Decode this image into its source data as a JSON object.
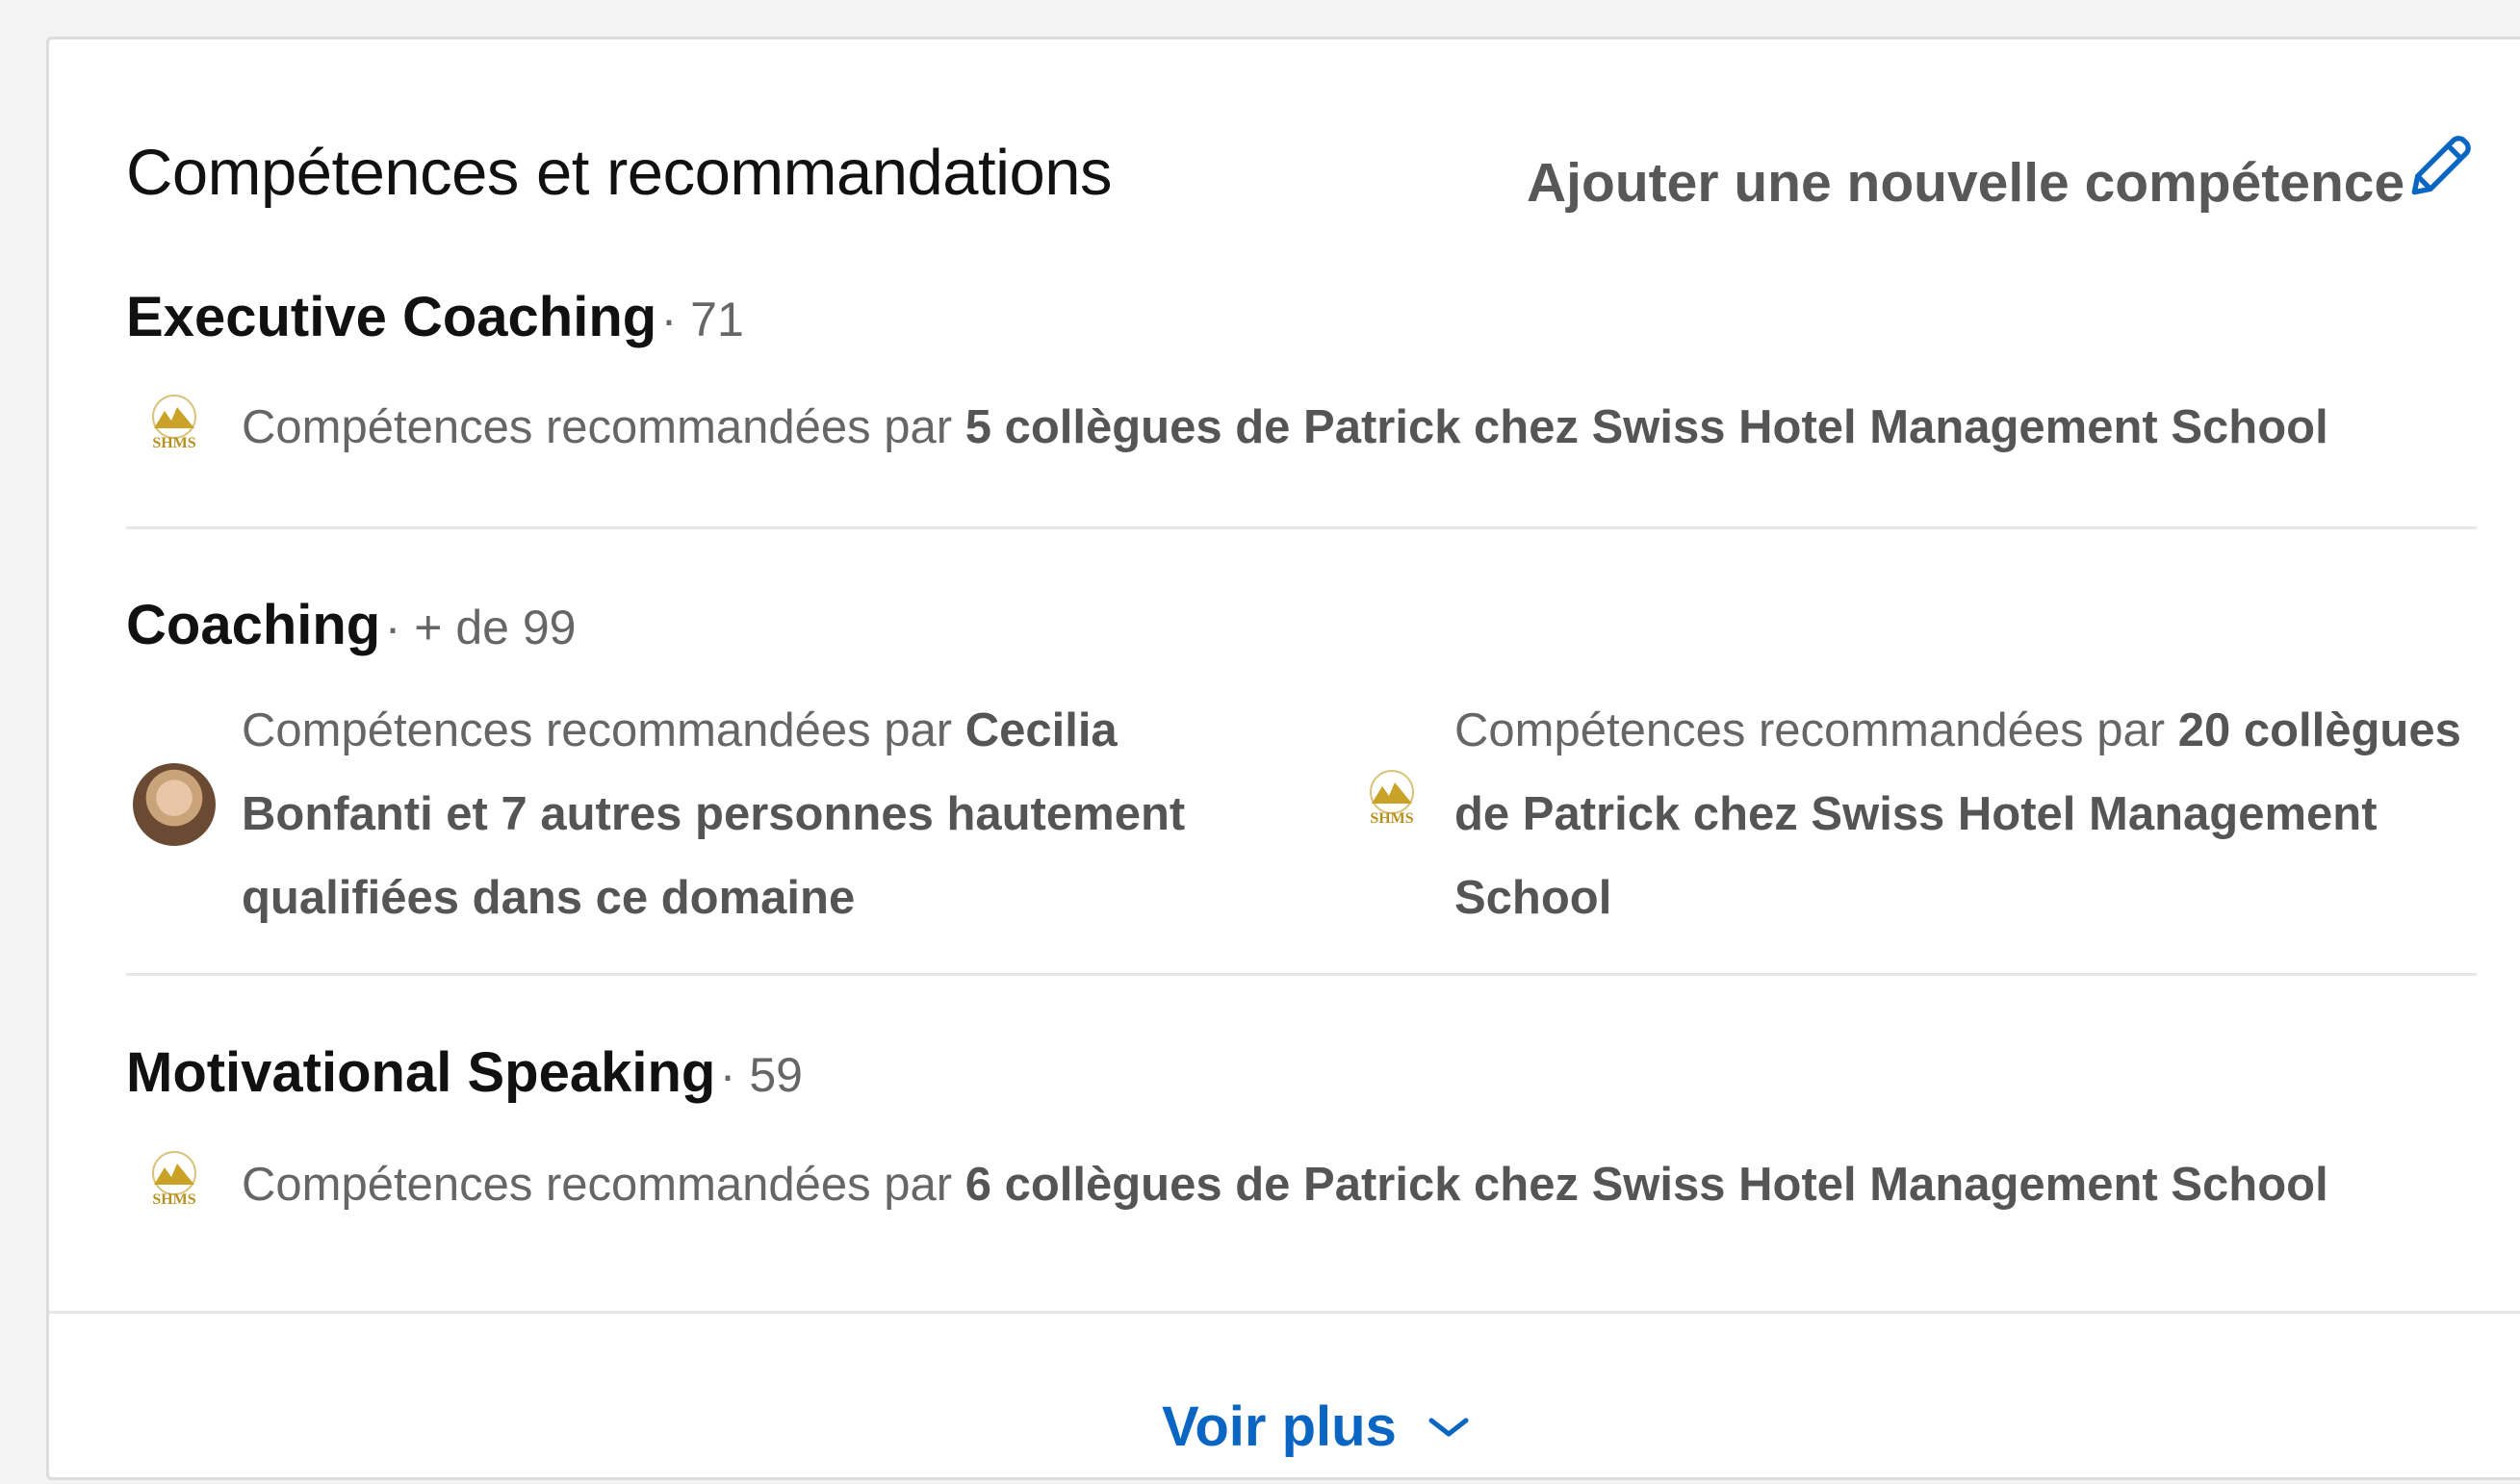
{
  "section": {
    "title": "Compétences et recommandations",
    "add_skill_label": "Ajouter une nouvelle compétence"
  },
  "skills": [
    {
      "name": "Executive Coaching",
      "count": "· 71",
      "endorsements": [
        {
          "source": "logo",
          "prefix": "Compétences recommandées par ",
          "bold": "5 collègues de Patrick chez Swiss Hotel Management School"
        }
      ]
    },
    {
      "name": "Coaching",
      "count": "· + de 99",
      "endorsements": [
        {
          "source": "avatar",
          "prefix": "Compétences recommandées par ",
          "bold": "Cecilia Bonfanti et 7 autres personnes hautement qualifiées dans ce domaine"
        },
        {
          "source": "logo",
          "prefix": "Compétences recommandées par ",
          "bold": "20 collègues de Patrick chez Swiss Hotel Management School"
        }
      ]
    },
    {
      "name": "Motivational Speaking",
      "count": "· 59",
      "endorsements": [
        {
          "source": "logo",
          "prefix": "Compétences recommandées par ",
          "bold": "6 collègues de Patrick chez Swiss Hotel Management School"
        }
      ]
    }
  ],
  "logo": {
    "icon": "shms-logo-icon",
    "label": "SHMS",
    "color": "#c9a227"
  },
  "footer": {
    "see_more_label": "Voir plus",
    "accent_color": "#0a66c2"
  }
}
